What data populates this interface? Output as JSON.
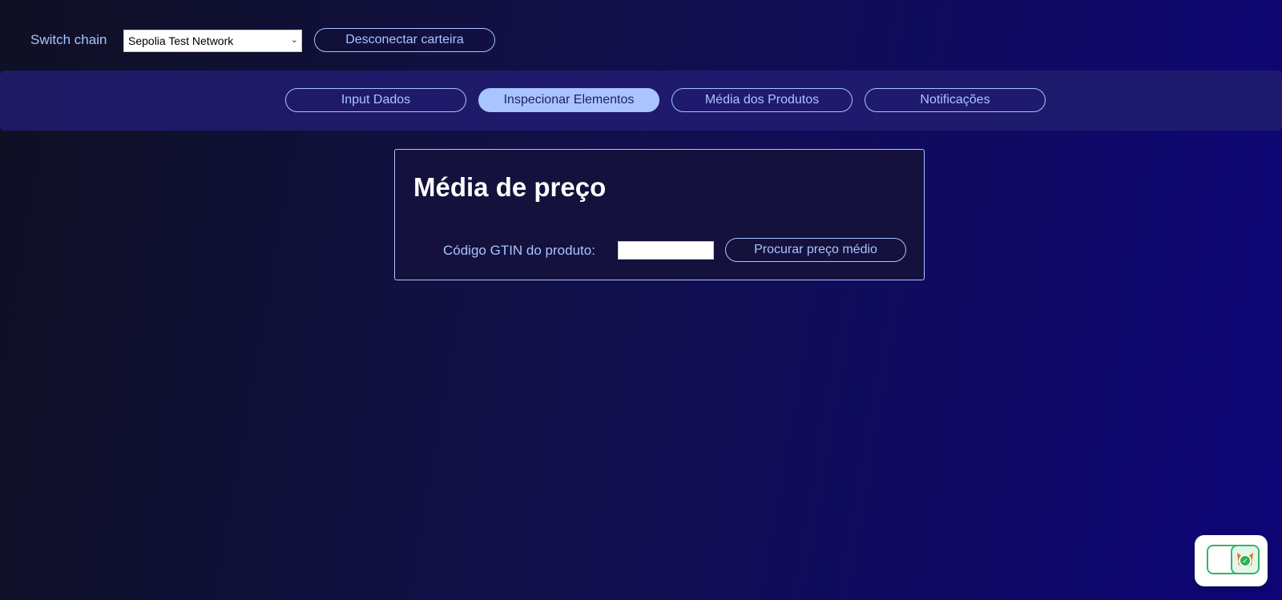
{
  "header": {
    "switch_chain_label": "Switch chain",
    "chain_select_value": "Sepolia Test Network",
    "disconnect_label": "Desconectar carteira"
  },
  "nav": {
    "tabs": [
      {
        "label": "Input Dados",
        "active": false
      },
      {
        "label": "Inspecionar Elementos",
        "active": true
      },
      {
        "label": "Média dos Produtos",
        "active": false
      },
      {
        "label": "Notificações",
        "active": false
      }
    ]
  },
  "card": {
    "title": "Média de preço",
    "gtin_label": "Código GTIN do produto:",
    "gtin_value": "",
    "search_button": "Procurar preço médio"
  },
  "colors": {
    "accent": "#a9c4ff",
    "nav_bg": "#1e1a64",
    "card_bg": "#14113c",
    "connected_green": "#2bb15a"
  },
  "icons": {
    "select_chevron": "chevron-down-icon",
    "wallet_widget": "metamask-fox-icon",
    "connected_badge": "check-icon"
  }
}
